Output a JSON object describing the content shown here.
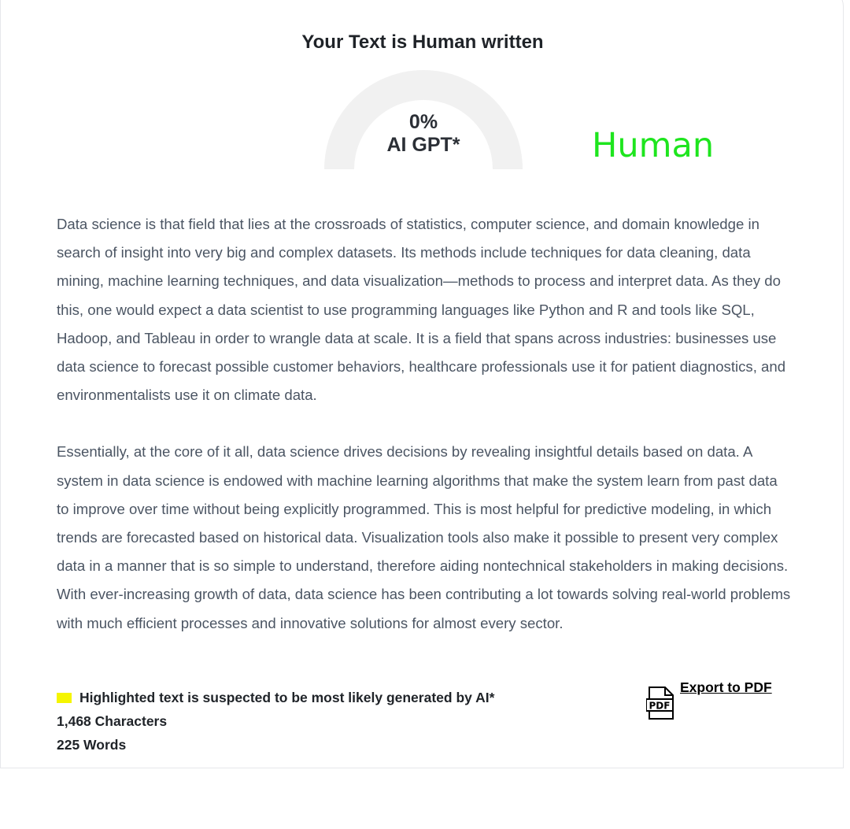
{
  "result": {
    "title": "Your Text is Human written",
    "gauge_percent_label": "0%",
    "gauge_percent_value": 0,
    "gauge_caption": "AI GPT*",
    "verdict": "Human"
  },
  "content": {
    "paragraphs": [
      "Data science is that field that lies at the crossroads of statistics, computer science, and domain knowledge in search of insight into very big and complex datasets. Its methods include techniques for data cleaning, data mining, machine learning techniques, and data visualization—methods to process and interpret data. As they do this, one would expect a data scientist to use programming languages like Python and R and tools like SQL, Hadoop, and Tableau in order to wrangle data at scale. It is a field that spans across industries: businesses use data science to forecast possible customer behaviors, healthcare professionals use it for patient diagnostics, and environmentalists use it on climate data.",
      "Essentially, at the core of it all, data science drives decisions by revealing insightful details based on data. A system in data science is endowed with machine learning algorithms that make the system learn from past data to improve over time without being explicitly programmed. This is most helpful for predictive modeling, in which trends are forecasted based on historical data. Visualization tools also make it possible to present very complex data in a manner that is so simple to understand, therefore aiding nontechnical stakeholders in making decisions. With ever-increasing growth of data, data science has been contributing a lot towards solving real-world problems with much efficient processes and innovative solutions for almost every sector."
    ]
  },
  "footer": {
    "legend_text": "Highlighted text is suspected to be most likely generated by AI*",
    "characters": "1,468 Characters",
    "words": "225 Words",
    "export_label": "Export to PDF",
    "pdf_icon_text": "PDF"
  },
  "colors": {
    "verdict": "#1ee51e",
    "gauge_track": "#f1f1f1",
    "highlight": "#f5f500"
  },
  "icons": {
    "export": "pdf-file-icon"
  }
}
